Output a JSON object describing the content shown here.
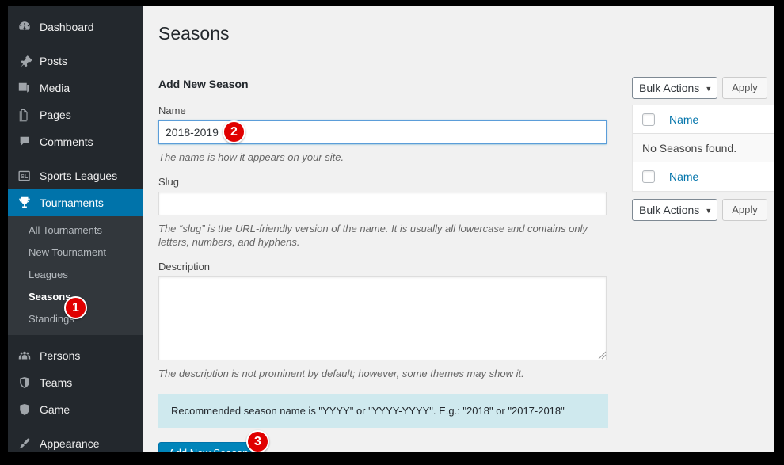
{
  "sidebar": {
    "items": [
      {
        "label": "Dashboard",
        "icon": "dashboard-icon"
      },
      {
        "label": "Posts",
        "icon": "pin-icon"
      },
      {
        "label": "Media",
        "icon": "media-icon"
      },
      {
        "label": "Pages",
        "icon": "pages-icon"
      },
      {
        "label": "Comments",
        "icon": "comment-icon"
      },
      {
        "label": "Sports Leagues",
        "icon": "sl-badge-icon"
      },
      {
        "label": "Tournaments",
        "icon": "trophy-icon"
      },
      {
        "label": "Persons",
        "icon": "persons-icon"
      },
      {
        "label": "Teams",
        "icon": "shield-split-icon"
      },
      {
        "label": "Game",
        "icon": "shield-icon"
      },
      {
        "label": "Appearance",
        "icon": "paintbrush-icon"
      }
    ],
    "submenu": [
      {
        "label": "All Tournaments"
      },
      {
        "label": "New Tournament"
      },
      {
        "label": "Leagues"
      },
      {
        "label": "Seasons"
      },
      {
        "label": "Standings"
      }
    ],
    "active_top": "Tournaments",
    "active_sub": "Seasons",
    "colors": {
      "background": "#23282d",
      "submenu_background": "#32373c",
      "highlight": "#0073aa"
    }
  },
  "page": {
    "title": "Seasons"
  },
  "form": {
    "heading": "Add New Season",
    "name": {
      "label": "Name",
      "value": "2018-2019",
      "placeholder": "",
      "help": "The name is how it appears on your site."
    },
    "slug": {
      "label": "Slug",
      "value": "",
      "placeholder": "",
      "help": "The “slug” is the URL-friendly version of the name. It is usually all lowercase and contains only letters, numbers, and hyphens."
    },
    "description": {
      "label": "Description",
      "value": "",
      "placeholder": "",
      "help": "The description is not prominent by default; however, some themes may show it."
    },
    "notice": "Recommended season name is \"YYYY\" or \"YYYY-YYYY\". E.g.: \"2018\" or \"2017-2018\"",
    "submit_label": "Add New Season",
    "submit_color": "#0085ba"
  },
  "list_table": {
    "bulk_actions_top": {
      "selected": "Bulk Actions",
      "caret": "▼",
      "apply_label": "Apply"
    },
    "bulk_actions_bottom": {
      "selected": "Bulk Actions",
      "caret": "▼",
      "apply_label": "Apply"
    },
    "header_columns": [
      "Name"
    ],
    "footer_columns": [
      "Name"
    ],
    "empty_message": "No Seasons found."
  },
  "steps": [
    {
      "number": "1",
      "target": "sidebar-item-seasons"
    },
    {
      "number": "2",
      "target": "name-input"
    },
    {
      "number": "3",
      "target": "add-new-season-button"
    }
  ],
  "annotation_color": "#e00000"
}
